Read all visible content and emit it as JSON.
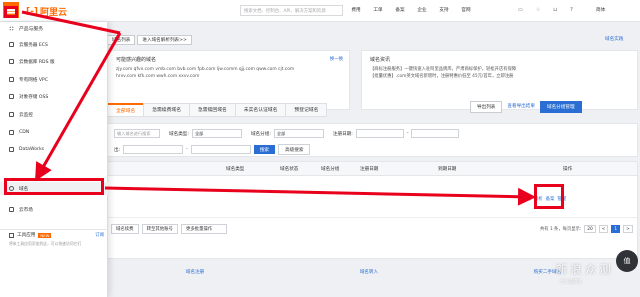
{
  "topbar": {
    "logo_mark": "[-]",
    "logo_text": "阿里云",
    "search_placeholder": "搜索文档、控制台、API、解决方案和资源",
    "nav": [
      "费用",
      "工单",
      "备案",
      "企业",
      "支持",
      "官网"
    ],
    "user": "简体"
  },
  "main": {
    "crumbs": [
      "域名列表",
      "进入域名解析列表>>"
    ],
    "help_link": "域名实践",
    "info_card": {
      "title": "可能感兴趣的域名",
      "more": "换一换",
      "lines": [
        "zjy.com  qfvx.com  vmb.com  bvb.com  fpb.com  ljw.comm  qjj.com  qww.com  cjt.com",
        "hrvv.com  kfk.com  wwh.com  xxvv.com"
      ]
    },
    "promo_card": {
      "title": "域名资讯",
      "lines": [
        "【商标注册服务】一键快速入驻阿里品牌库，严肃商标保护，轻松开店有保障",
        "【批量优惠】.com英文域名新增时，注册特惠价低至 45元/首年，立即注册"
      ]
    },
    "action_buttons": [
      "导出列表",
      "查看导出结果",
      "域名分组管理"
    ],
    "tabs": [
      "全部域名",
      "急需续费域名",
      "急需赎回域名",
      "未实名认证域名",
      "预登记域名"
    ],
    "filters": {
      "row1": {
        "search_placeholder": "输入域名进行搜索",
        "type_label": "域名类型:",
        "type_value": "全部",
        "group_label": "域名分组:",
        "group_value": "全部",
        "date_label": "注册日期:",
        "date_sep": "-"
      },
      "row2": {
        "prefix_label": "出:",
        "date_sep": "-",
        "search_button": "搜索",
        "advanced_button": "高级搜索"
      }
    },
    "table": {
      "headers": [
        "域名类型",
        "域名状态",
        "域名分组",
        "注册日期",
        "到期日期",
        "操作"
      ],
      "row_actions": [
        "续费",
        "解析",
        "备案",
        "管理"
      ],
      "footer_buttons": [
        "域名续费",
        "转至其他账号",
        "更多批量操作"
      ],
      "pager_text": "共有 1 条，每页显示:",
      "page_size": "20",
      "pages": [
        "<",
        "1",
        ">"
      ],
      "bottom_links": [
        "域名注册",
        "域名转入",
        "购买二手域名"
      ]
    }
  },
  "side": {
    "header": "产品与服务",
    "items": [
      {
        "label": "云服务器 ECS"
      },
      {
        "label": "云数据库 RDS 版"
      },
      {
        "label": "专有网络 VPC"
      },
      {
        "label": "对象存储 OSS"
      },
      {
        "label": "云监控"
      },
      {
        "label": "CDN"
      },
      {
        "label": "DataWorks"
      },
      {
        "label": "域名"
      },
      {
        "label": "云市场"
      }
    ],
    "toolbox": {
      "label": "工具应用",
      "badge": "NEW",
      "subscribe": "订阅",
      "desc": "将来工具应用添加到这，可以快速访问它们"
    }
  },
  "watermark": {
    "text": "新 浪 众 测",
    "sub": "什么值得买",
    "logo": "值"
  },
  "colors": {
    "brand": "#ff6a00",
    "link": "#2a6ed4",
    "annotation": "#e8001c"
  }
}
